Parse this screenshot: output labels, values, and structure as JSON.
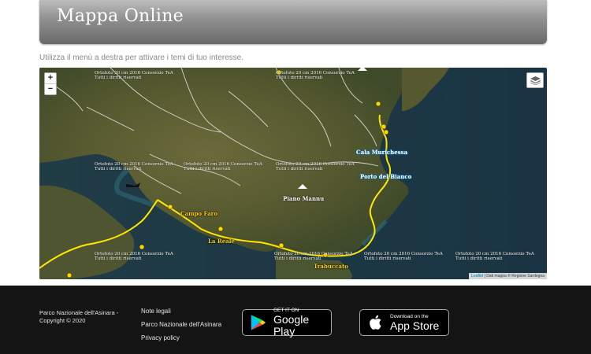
{
  "header": {
    "title": "Mappa Online"
  },
  "intro_text": "Utilizza il menù a destra per attivare i temi di tuo interesse.",
  "map": {
    "zoom_in": "+",
    "zoom_out": "−",
    "attribution_link": "Leaflet",
    "attribution_text": " | Dati mappa © Regione Sardegna",
    "watermark_line1": "Ortofoto 20 cm 2016 Consorzio TeA",
    "watermark_line2": "Tutti i diritti riservati",
    "places": {
      "cala_murichessa": "Cala Murichessa",
      "porto_del_bianco": "Porto del Bianco",
      "piano_mannu": "Piano Mannu",
      "campo_faro": "Campo Faro",
      "la_reale": "La Reale",
      "trabuccato": "Trabuccato"
    },
    "colors": {
      "sea": "#1d3b4a",
      "land": "#5a5e36",
      "trail": "#ffe800",
      "roads": "#f2f2f2"
    }
  },
  "footer": {
    "copyright_line1": "Parco Nazionale dell'Asinara -",
    "copyright_line2": "Copyright © 2020",
    "links": [
      "Note legali",
      "Parco Nazionale dell'Asinara",
      "Privacy policy"
    ],
    "google_play": {
      "small": "GET IT ON",
      "big": "Google Play"
    },
    "app_store": {
      "small": "Download on the",
      "big": "App Store"
    }
  }
}
